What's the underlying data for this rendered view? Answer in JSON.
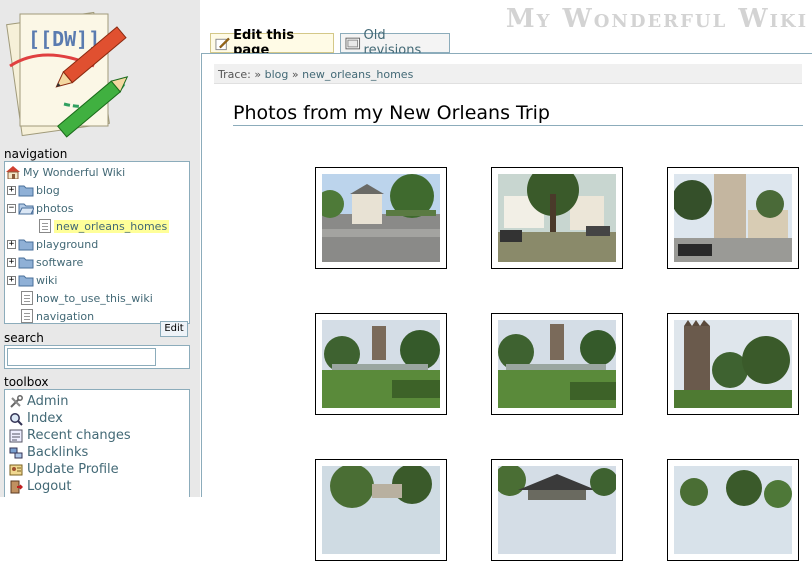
{
  "site": {
    "title": "My Wonderful Wiki"
  },
  "tabs": {
    "edit": "Edit this page",
    "revisions": "Old revisions"
  },
  "sidebar": {
    "navigation_title": "navigation",
    "tree": [
      {
        "label": "My Wonderful Wiki",
        "type": "home"
      },
      {
        "label": "blog",
        "type": "folder-closed"
      },
      {
        "label": "photos",
        "type": "folder-open"
      },
      {
        "label": "new_orleans_homes",
        "type": "page",
        "current": true
      },
      {
        "label": "playground",
        "type": "folder-closed"
      },
      {
        "label": "software",
        "type": "folder-closed"
      },
      {
        "label": "wiki",
        "type": "folder-closed"
      },
      {
        "label": "how_to_use_this_wiki",
        "type": "page"
      },
      {
        "label": "navigation",
        "type": "page"
      }
    ],
    "edit_button": "Edit",
    "search_title": "search",
    "search_value": "",
    "toolbox_title": "toolbox",
    "toolbox": [
      {
        "label": "Admin",
        "icon": "admin-icon"
      },
      {
        "label": "Index",
        "icon": "index-icon"
      },
      {
        "label": "Recent changes",
        "icon": "recent-changes-icon"
      },
      {
        "label": "Backlinks",
        "icon": "backlinks-icon"
      },
      {
        "label": "Update Profile",
        "icon": "profile-icon"
      },
      {
        "label": "Logout",
        "icon": "logout-icon"
      }
    ]
  },
  "breadcrumb": {
    "prefix": "Trace:",
    "sep": "»",
    "items": [
      "blog",
      "new_orleans_homes"
    ]
  },
  "page": {
    "title": "Photos from my New Orleans Trip"
  },
  "colors": {
    "link": "#436976",
    "border": "#8cacbb",
    "sidebar_bg": "#e8e8e8",
    "current_highlight": "#ffff99"
  }
}
